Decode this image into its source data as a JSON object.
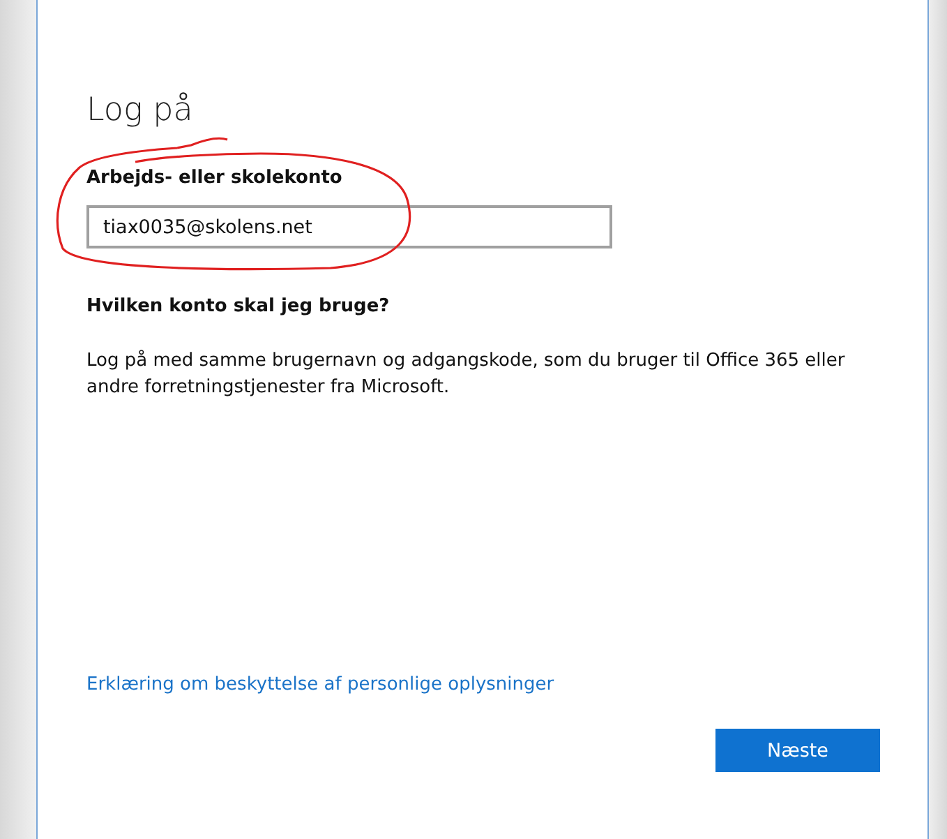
{
  "dialog": {
    "title": "Log på",
    "account_field": {
      "label": "Arbejds- eller skolekonto",
      "value": "tiax0035@skolens.net"
    },
    "help_heading": "Hvilken konto skal jeg bruge?",
    "help_text": "Log på med samme brugernavn og adgangskode, som du bruger til Office 365 eller andre forretningstjenester fra Microsoft.",
    "privacy_link": "Erklæring om beskyttelse af personlige oplysninger",
    "buttons": [
      {
        "label": "Næste",
        "kind": "primary"
      }
    ]
  }
}
